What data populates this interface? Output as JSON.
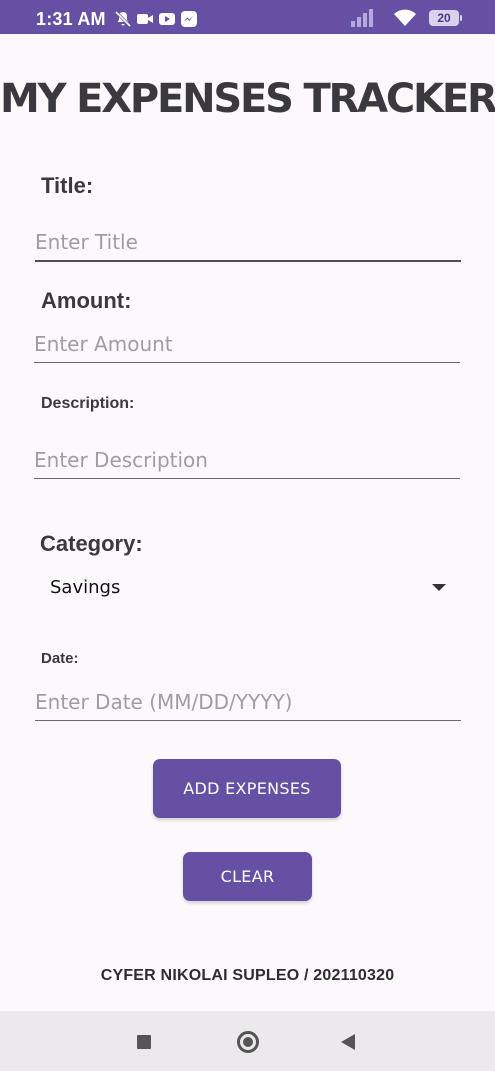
{
  "status_bar": {
    "time": "1:31 AM",
    "left_icons": [
      "mute-icon",
      "video-call-icon",
      "youtube-icon",
      "messenger-icon"
    ],
    "right_icons": [
      "signal-icon",
      "wifi-icon"
    ],
    "battery": "20",
    "background": "#6650a4"
  },
  "app": {
    "title": "MY EXPENSES TRACKER"
  },
  "form": {
    "title_label": "Title:",
    "title_placeholder": "Enter Title",
    "amount_label": "Amount:",
    "amount_placeholder": "Enter Amount",
    "description_label": "Description:",
    "description_placeholder": "Enter Description",
    "category_label": "Category:",
    "category_value": "Savings",
    "date_label": "Date:",
    "date_placeholder": "Enter Date (MM/DD/YYYY)"
  },
  "buttons": {
    "add": "ADD EXPENSES",
    "clear": "CLEAR",
    "color": "#6650a4"
  },
  "footer": {
    "text": "CYFER NIKOLAI SUPLEO / 202110320"
  },
  "nav": {
    "icons": [
      "recents-square-icon",
      "home-circle-icon",
      "back-triangle-icon"
    ]
  }
}
